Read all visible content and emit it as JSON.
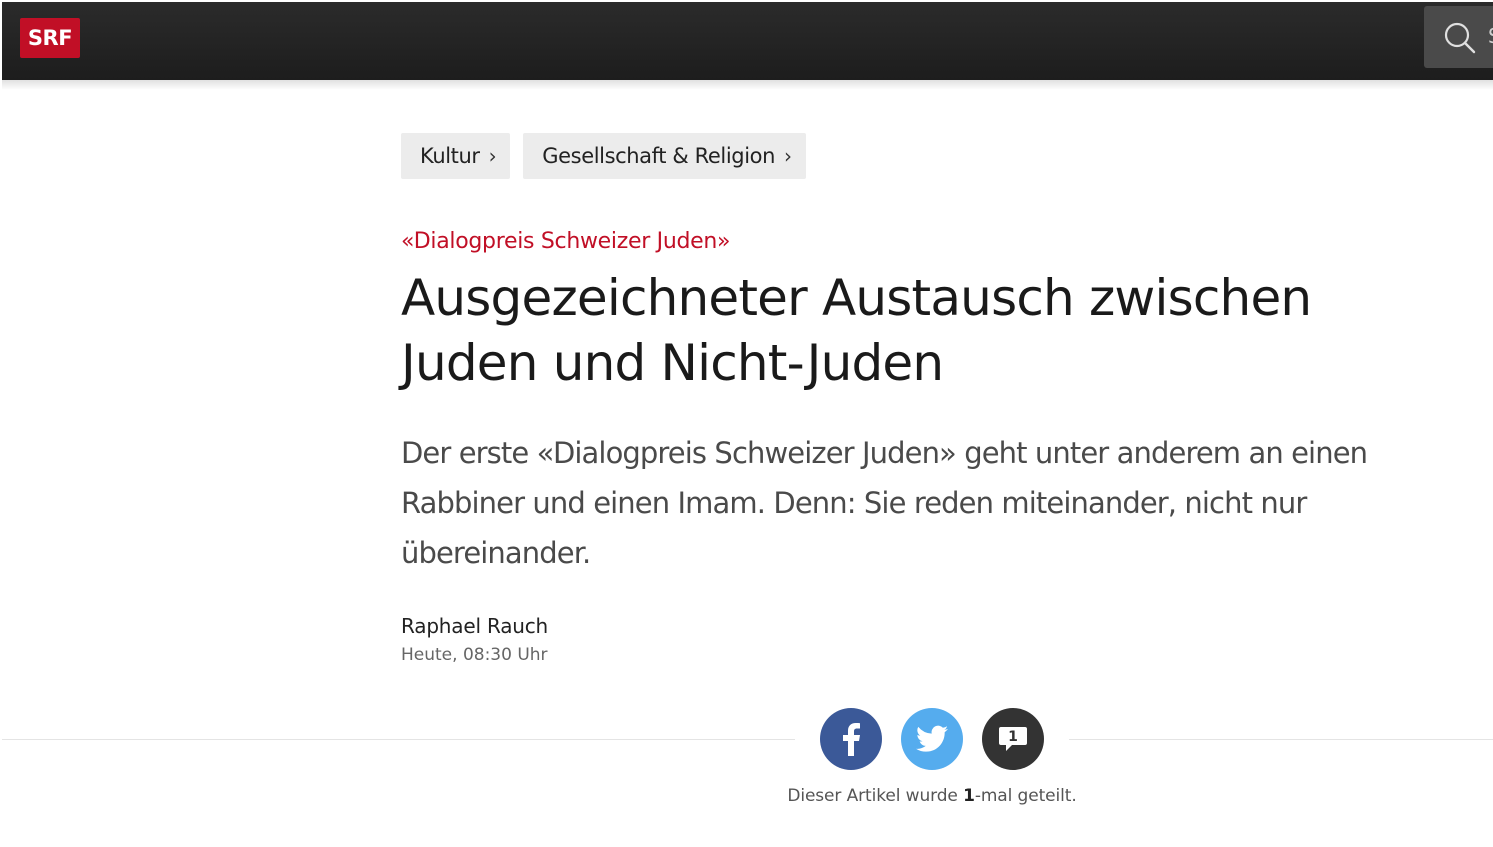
{
  "header": {
    "logo_text": "SRF",
    "search_hint": "S",
    "logo_color": "#c10f26"
  },
  "breadcrumb": [
    {
      "label": "Kultur"
    },
    {
      "label": "Gesellschaft & Religion"
    }
  ],
  "article": {
    "kicker": "«Dialogpreis Schweizer Juden»",
    "title": "Ausgezeichneter Austausch zwischen Juden und Nicht-Juden",
    "lead": "Der erste «Dialogpreis Schweizer Juden» geht unter anderem an einen Rabbiner und einen Imam. Denn: Sie reden miteinander, nicht nur übereinander.",
    "author": "Raphael Rauch",
    "timestamp": "Heute, 08:30 Uhr"
  },
  "share": {
    "buttons": [
      {
        "icon": "facebook-icon",
        "color": "#3b5998"
      },
      {
        "icon": "twitter-icon",
        "color": "#55acee"
      },
      {
        "icon": "comment-icon",
        "color": "#333333",
        "count": "1"
      }
    ],
    "count_prefix": "Dieser Artikel wurde ",
    "count_value": "1",
    "count_suffix": "-mal geteilt."
  }
}
